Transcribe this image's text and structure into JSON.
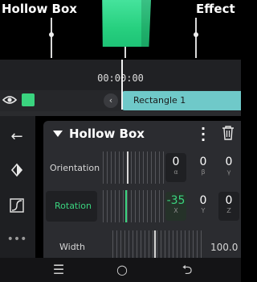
{
  "preview": {
    "left_label": "Hollow Box",
    "right_label": "Effect",
    "object_color": "#2fd487"
  },
  "timeline": {
    "timecode": "00:00:00",
    "layer": {
      "swatch_color": "#3ad47f",
      "clip_name": "Rectangle 1",
      "clip_color": "#6fc9c9"
    }
  },
  "sidebar": {
    "icons": [
      "back-arrow-icon",
      "keyframe-diamond-icon",
      "easing-curve-icon",
      "more-dots-icon"
    ]
  },
  "panel": {
    "title": "Hollow Box",
    "rows": [
      {
        "label": "Orientation",
        "values": [
          {
            "value": "0",
            "axis": "α"
          },
          {
            "value": "0",
            "axis": "β"
          },
          {
            "value": "0",
            "axis": "γ"
          }
        ]
      },
      {
        "label": "Rotation",
        "values": [
          {
            "value": "-35",
            "axis": "X"
          },
          {
            "value": "0",
            "axis": "Y"
          },
          {
            "value": "0",
            "axis": "Z"
          }
        ]
      },
      {
        "label": "Width",
        "value": "100.0"
      }
    ]
  },
  "navbar": {
    "recent": "☰",
    "home": "○",
    "back": "⮌"
  },
  "colors": {
    "accent": "#3ad47f",
    "panel_bg": "#2b2c30"
  }
}
